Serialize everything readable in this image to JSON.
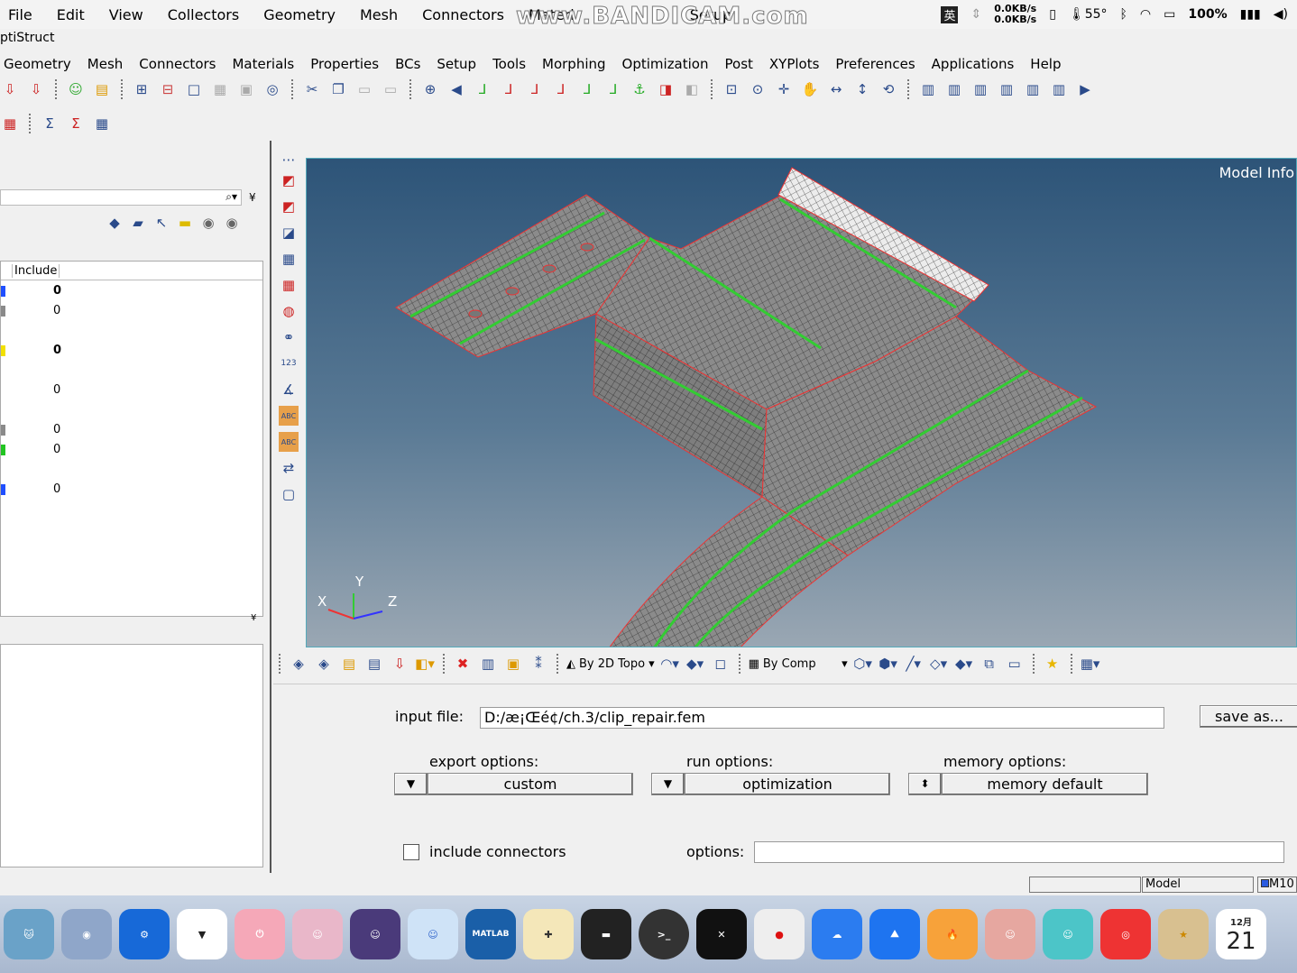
{
  "topbar": {
    "menus": [
      "File",
      "Edit",
      "View",
      "Collectors",
      "Geometry",
      "Mesh",
      "Connectors",
      "Materi",
      "Setup"
    ],
    "ime": "英",
    "net_up": "0.0KB/s",
    "net_down": "0.0KB/s",
    "temp": "55°",
    "battery": "100%",
    "watermark": "www.BANDICAM.com"
  },
  "app_title": "ptiStruct",
  "menubar": [
    "Geometry",
    "Mesh",
    "Connectors",
    "Materials",
    "Properties",
    "BCs",
    "Setup",
    "Tools",
    "Morphing",
    "Optimization",
    "Post",
    "XYPlots",
    "Preferences",
    "Applications",
    "Help"
  ],
  "left_panel": {
    "column_header": "Include",
    "rows": [
      {
        "color": "#1f4fff",
        "value": "0",
        "bold": true
      },
      {
        "color": "#8a8a8a",
        "value": "0",
        "bold": false
      },
      {
        "color": "#f2e000",
        "value": "0",
        "bold": true
      },
      {
        "color": "",
        "value": "0",
        "bold": false
      },
      {
        "color": "#8a8a8a",
        "value": "0",
        "bold": false
      },
      {
        "color": "#22c422",
        "value": "0",
        "bold": false
      },
      {
        "color": "#1f4fff",
        "value": "0",
        "bold": false
      }
    ]
  },
  "viewport": {
    "model_info": "Model Info",
    "axis_x": "X",
    "axis_y": "Y",
    "axis_z": "Z"
  },
  "lower_toolbar": {
    "topo_mode": "By 2D Topo",
    "color_mode": "By Comp"
  },
  "bottom_panel": {
    "input_file_label": "input file:",
    "input_file_value": "D:/æ¡Œé¢/ch.3/clip_repair.fem",
    "save_as": "save as...",
    "export_label": "export options:",
    "export_value": "custom",
    "run_label": "run options:",
    "run_value": "optimization",
    "memory_label": "memory options:",
    "memory_value": "memory default",
    "include_connectors": "include connectors",
    "options_label": "options:",
    "options_value": ""
  },
  "statusbar": {
    "model": "Model",
    "m10": "M10"
  },
  "dock": {
    "matlab": "MATLAB",
    "calendar_month": "12月",
    "calendar_day": "21"
  }
}
